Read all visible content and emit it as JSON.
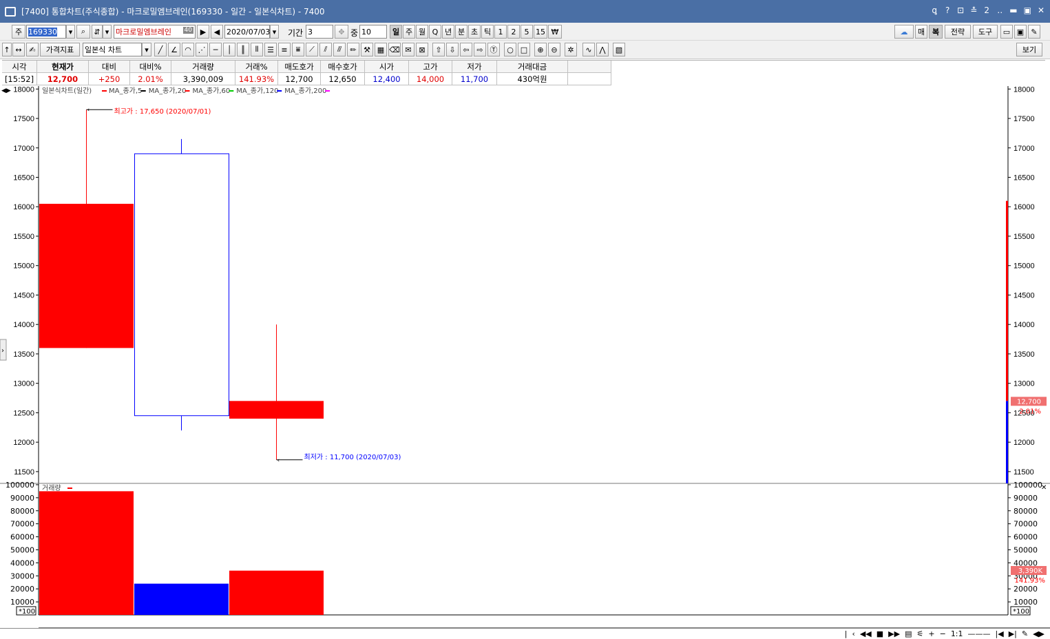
{
  "window": {
    "title": "[7400] 통합차트(주식종합) - 마크로밀엠브레인(169330 - 일간 - 일본식차트) - 7400",
    "controls": [
      "ꝗ",
      "?",
      "⊡",
      "≛",
      "2",
      "‥",
      "▬",
      "▣",
      "✕"
    ]
  },
  "toolbar1": {
    "market_label": "주",
    "code_value": "169330",
    "stock_name": "마크로밀엠브레인",
    "badge": "40",
    "date_value": "2020/07/03",
    "period_label": "기간",
    "period_value": "3",
    "count_label": "중",
    "count_value": "10",
    "period_buttons": [
      "일",
      "주",
      "월",
      "Q",
      "년",
      "분",
      "초",
      "틱",
      "1",
      "2",
      "5",
      "15",
      "₩"
    ],
    "right_buttons": [
      "매",
      "복",
      "전략",
      "도구"
    ]
  },
  "toolbar2": {
    "indicator_btn": "가격지표",
    "chart_type": "일본식 차트",
    "view_btn": "보기"
  },
  "quote": {
    "headers": [
      "시각",
      "현재가",
      "대비",
      "대비%",
      "거래량",
      "거래%",
      "매도호가",
      "매수호가",
      "시가",
      "고가",
      "저가",
      "거래대금"
    ],
    "values": [
      "[15:52]",
      "12,700",
      "+250",
      "2.01%",
      "3,390,009",
      "141.93%",
      "12,700",
      "12,650",
      "12,400",
      "14,000",
      "11,700",
      "430억원"
    ]
  },
  "colors": {
    "up": "#ff0000",
    "down": "#0000ff",
    "ma5": "#ff0000",
    "ma20": "#000000",
    "ma60": "#ff0000",
    "ma120": "#00cc00",
    "ma200": "#0000ff",
    "extra": "#ff00ff"
  },
  "chart_data": [
    {
      "type": "candlestick",
      "legend": "일본식차트(일간)",
      "ma_legend": [
        "MA_종가,5",
        "MA_종가,20",
        "MA_종가,60",
        "MA_종가,120",
        "MA_종가,200"
      ],
      "candles": [
        {
          "open": 13600,
          "high": 17650,
          "low": 13600,
          "close": 16050,
          "dir": "up"
        },
        {
          "open": 16900,
          "high": 17150,
          "low": 12200,
          "close": 12450,
          "dir": "down"
        },
        {
          "open": 12400,
          "high": 14000,
          "low": 11700,
          "close": 12700,
          "dir": "up"
        }
      ],
      "ylim": [
        11300,
        18050
      ],
      "yticks": [
        18000,
        17500,
        17000,
        16500,
        16000,
        15500,
        15000,
        14500,
        14000,
        13500,
        13000,
        12500,
        12000,
        11500
      ],
      "annotations": {
        "high": "최고가 : 17,650 (2020/07/01)",
        "low": "최저가 : 11,700 (2020/07/03)"
      },
      "current": {
        "price": 12700,
        "price_label": "12,700",
        "pct": "2.01%"
      }
    },
    {
      "type": "bar",
      "legend": "거래량",
      "values": [
        95000,
        24000,
        34000
      ],
      "colors": [
        "up",
        "down",
        "up"
      ],
      "ylim": [
        0,
        100500
      ],
      "yticks": [
        100000,
        90000,
        80000,
        70000,
        60000,
        50000,
        40000,
        30000,
        20000,
        10000
      ],
      "unit_label": "*100",
      "current": {
        "label": "3,390K",
        "pct": "141.93%"
      }
    }
  ]
}
